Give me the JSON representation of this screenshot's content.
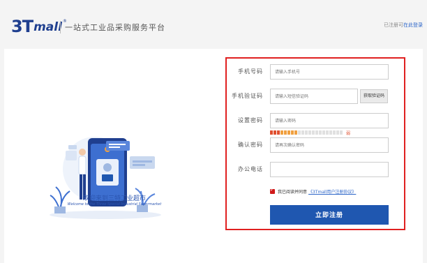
{
  "header": {
    "logo_main": "3T",
    "logo_suffix": "mall",
    "logo_reg": "®",
    "slogan": "一站式工业品采购服务平台",
    "login_prefix": "已注册可",
    "login_link": "在此登录"
  },
  "welcome": {
    "title": "欢迎来到三特工业超市",
    "subtitle": "Welcome to the Three Special Industrial Supermarket"
  },
  "form": {
    "phone": {
      "label": "手机号码",
      "placeholder": "请输入手机号"
    },
    "sms": {
      "label": "手机验证码",
      "placeholder": "请输入短信验证码",
      "button": "获取验证码"
    },
    "password": {
      "label": "设置密码",
      "placeholder": "请输入密码"
    },
    "strength": {
      "level_text": "弱",
      "level": 0.33
    },
    "confirm": {
      "label": "确认密码",
      "placeholder": "请再次确认密码"
    },
    "office_phone": {
      "label": "办公电话",
      "placeholder": ""
    },
    "agreement": {
      "checked": true,
      "text": "我已阅读并同意",
      "link": "《3Tmall用户注册协议》"
    },
    "submit": "立即注册"
  },
  "colors": {
    "brand": "#1f3f8f",
    "primary_button": "#1f57b0",
    "highlight_border": "#e02020",
    "link": "#2a64c8"
  }
}
